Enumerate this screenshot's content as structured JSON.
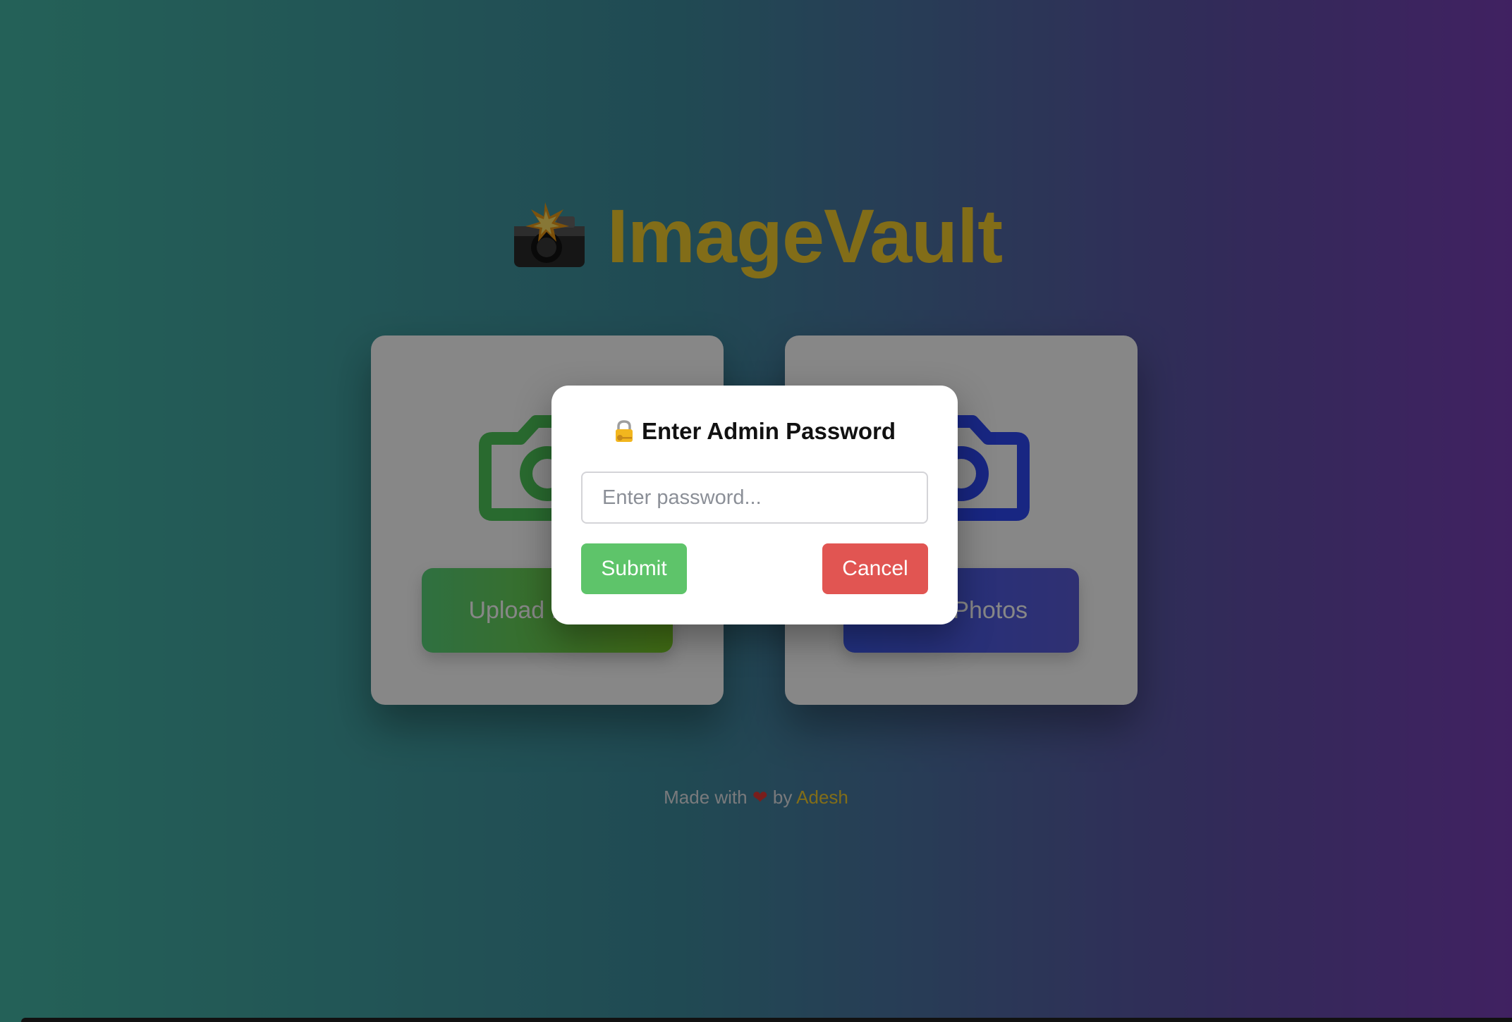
{
  "app": {
    "title": "ImageVault",
    "logo_icon": "camera-flash-icon"
  },
  "cards": {
    "upload": {
      "button_label": "Upload Photos",
      "icon": "camera-icon",
      "icon_color": "#4fc85a"
    },
    "view": {
      "button_label": "View Photos",
      "icon": "camera-icon",
      "icon_color": "#2f49f5"
    }
  },
  "footer": {
    "prefix": "Made with",
    "heart": "❤",
    "by": "by",
    "author": "Adesh"
  },
  "modal": {
    "title": "Enter Admin Password",
    "title_icon": "lock-key-icon",
    "password_placeholder": "Enter password...",
    "password_value": "",
    "submit_label": "Submit",
    "cancel_label": "Cancel"
  },
  "colors": {
    "accent_yellow": "#f5cf2f",
    "submit_green": "#5ec46a",
    "cancel_red": "#e15552"
  }
}
